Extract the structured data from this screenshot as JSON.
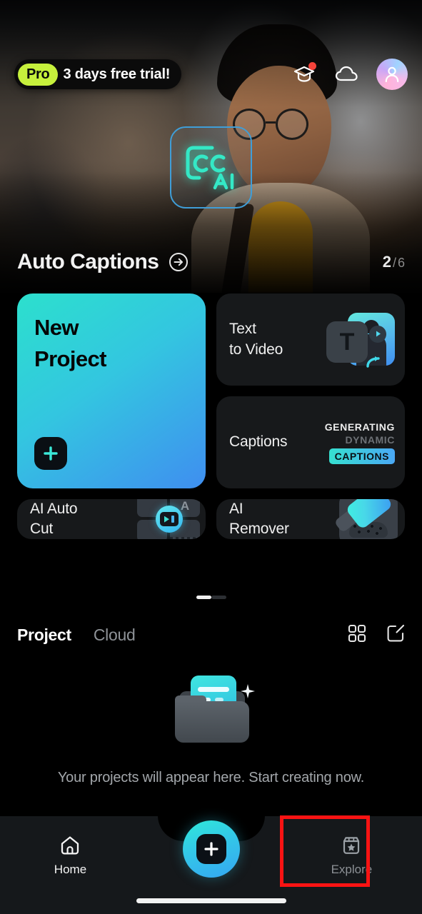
{
  "header": {
    "pro_badge": "Pro",
    "trial_text": "3 days free trial!",
    "icons": {
      "learn": "graduation-cap-icon",
      "cloud": "cloud-icon",
      "avatar": "avatar-icon"
    }
  },
  "hero": {
    "title": "Auto Captions",
    "arrow_icon": "arrow-right-circle-icon",
    "overlay_icon": "cc-ai-icon",
    "overlay_text_cc": "cc",
    "overlay_text_ai": "AI",
    "counter_current": "2",
    "counter_separator": "/",
    "counter_total": "6"
  },
  "features": {
    "new_project": {
      "line1": "New",
      "line2": "Project",
      "action_icon": "plus-icon",
      "gradient_from": "#2ce0cd",
      "gradient_to": "#3f8ef0"
    },
    "text_to_video": {
      "line1": "Text",
      "line2": "to Video",
      "art_letter": "T"
    },
    "captions": {
      "label": "Captions",
      "art_line1": "GENERATING",
      "art_line2": "DYNAMIC",
      "art_line3": "CAPTIONS"
    },
    "ai_auto_cut": {
      "line1": "AI Auto",
      "line2": "Cut",
      "art_letter": "A"
    },
    "ai_remover": {
      "line1": "AI",
      "line2": "Remover"
    }
  },
  "carousel": {
    "active_page": 1,
    "total_pages": 2
  },
  "projects": {
    "tab_project": "Project",
    "tab_cloud": "Cloud",
    "grid_icon": "grid-view-icon",
    "edit_icon": "edit-square-icon",
    "empty_message": "Your projects will appear here. Start creating now.",
    "empty_icon": "folder-document-icon"
  },
  "bottom_nav": {
    "home_label": "Home",
    "home_icon": "home-icon",
    "create_icon": "plus-icon",
    "explore_label": "Explore",
    "explore_icon": "store-star-icon"
  },
  "annotation": {
    "target": "Explore",
    "color": "#f91313"
  },
  "colors": {
    "accent_cyan": "#2ce0cd",
    "accent_blue": "#3f8ef0",
    "pro_green": "#c6f03c",
    "notification_red": "#f4433a",
    "background": "#000000",
    "card_background": "#17191b"
  }
}
